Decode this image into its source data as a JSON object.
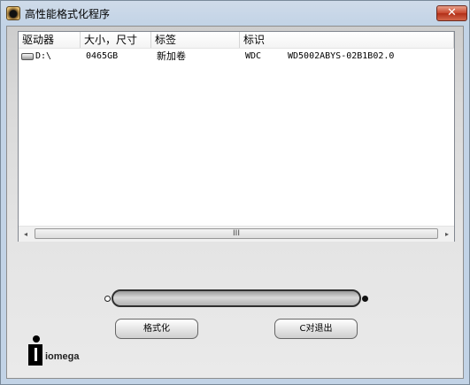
{
  "window": {
    "title": "高性能格式化程序",
    "close_label": "✕"
  },
  "listview": {
    "columns": [
      "驱动器",
      "大小，尺寸",
      "标签",
      "标识"
    ],
    "rows": [
      {
        "drive": "D:\\",
        "size": "0465GB",
        "label": "新加卷",
        "vendor": "WDC",
        "model": "WD5002ABYS-02B1B02.0"
      }
    ],
    "scroll": {
      "left_arrow": "◂",
      "right_arrow": "▸",
      "grip": "III"
    }
  },
  "progress": {
    "value": 0
  },
  "buttons": {
    "format": "格式化",
    "exit": "C对退出"
  },
  "brand": {
    "name": "iomega"
  },
  "icons": {
    "app": "format-app-icon",
    "close": "close-icon",
    "drive": "hard-drive-icon",
    "logo": "iomega-logo"
  },
  "colors": {
    "close_button": "#c7452c",
    "window_frame": "#c2d3e6",
    "client_bg": "#dcdcdc"
  }
}
